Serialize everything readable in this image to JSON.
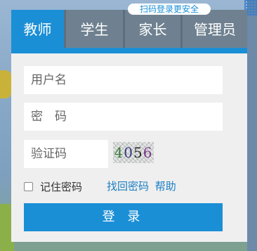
{
  "qr_login": {
    "label": "扫码登录更安全"
  },
  "tabs": [
    {
      "label": "教师",
      "active": true
    },
    {
      "label": "学生",
      "active": false
    },
    {
      "label": "家长",
      "active": false
    },
    {
      "label": "管理员",
      "active": false
    }
  ],
  "form": {
    "username_placeholder": "用户名",
    "password_placeholder": "密　码",
    "captcha_placeholder": "验证码",
    "captcha_digits": [
      "4",
      "0",
      "5",
      "6"
    ],
    "remember_label": "记住密码",
    "remember_checked": false,
    "forgot_password": "找回密码",
    "help": "帮助",
    "login_button": "登 录"
  },
  "colors": {
    "accent": "#1b8fd6",
    "tab_inactive": "#6f8190",
    "link": "#1b7fc4"
  }
}
